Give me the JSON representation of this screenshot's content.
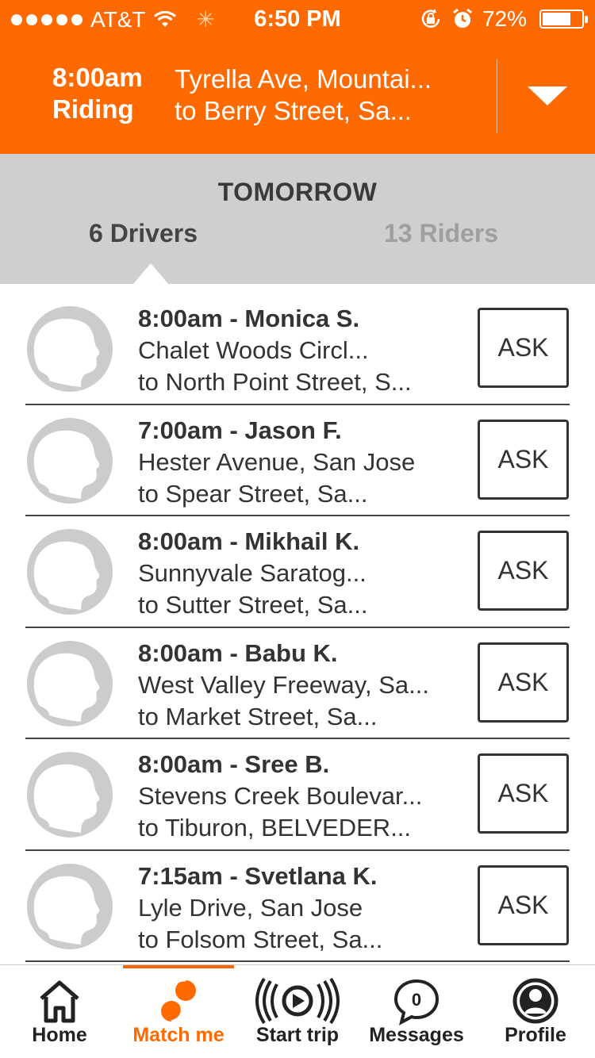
{
  "status_bar": {
    "carrier": "AT&T",
    "time": "6:50 PM",
    "battery": "72%",
    "battery_level": 0.72,
    "signal_bars": 5,
    "icons": [
      "signal-dots-icon",
      "wifi-icon",
      "activity-spinner-icon",
      "rotation-lock-icon",
      "alarm-icon",
      "battery-icon"
    ]
  },
  "trip": {
    "time": "8:00am",
    "status": "Riding",
    "from": "Tyrella Ave, Mountai...",
    "to": "to Berry Street, Sa..."
  },
  "segment": {
    "day": "TOMORROW",
    "drivers_tab": "6 Drivers",
    "riders_tab": "13 Riders",
    "selected": "drivers"
  },
  "drivers": [
    {
      "title": "8:00am - Monica S.",
      "from": "Chalet Woods Circl...",
      "to": "to North Point Street, S...",
      "action": "ASK"
    },
    {
      "title": "7:00am - Jason F.",
      "from": "Hester Avenue, San Jose",
      "to": "to Spear Street, Sa...",
      "action": "ASK"
    },
    {
      "title": "8:00am - Mikhail K.",
      "from": "Sunnyvale Saratog...",
      "to": "to Sutter Street, Sa...",
      "action": "ASK"
    },
    {
      "title": "8:00am - Babu K.",
      "from": "West Valley Freeway, Sa...",
      "to": "to Market Street, Sa...",
      "action": "ASK"
    },
    {
      "title": "8:00am - Sree B.",
      "from": "Stevens Creek Boulevar...",
      "to": "to Tiburon, BELVEDER...",
      "action": "ASK"
    },
    {
      "title": "7:15am - Svetlana K.",
      "from": "Lyle Drive, San Jose",
      "to": "to Folsom Street, Sa...",
      "action": "ASK"
    }
  ],
  "tabbar": {
    "tabs": [
      {
        "label": "Home",
        "icon": "home-icon"
      },
      {
        "label": "Match me",
        "icon": "match-me-icon"
      },
      {
        "label": "Start trip",
        "icon": "start-trip-icon"
      },
      {
        "label": "Messages",
        "icon": "messages-icon",
        "badge": "0"
      },
      {
        "label": "Profile",
        "icon": "profile-icon"
      }
    ],
    "active": "Match me"
  },
  "colors": {
    "brand": "#ff6a00",
    "segment_bg": "#cfcfcf",
    "avatar": "#cccccc",
    "text": "#333333",
    "inactive_tab": "#9f9f9f"
  }
}
